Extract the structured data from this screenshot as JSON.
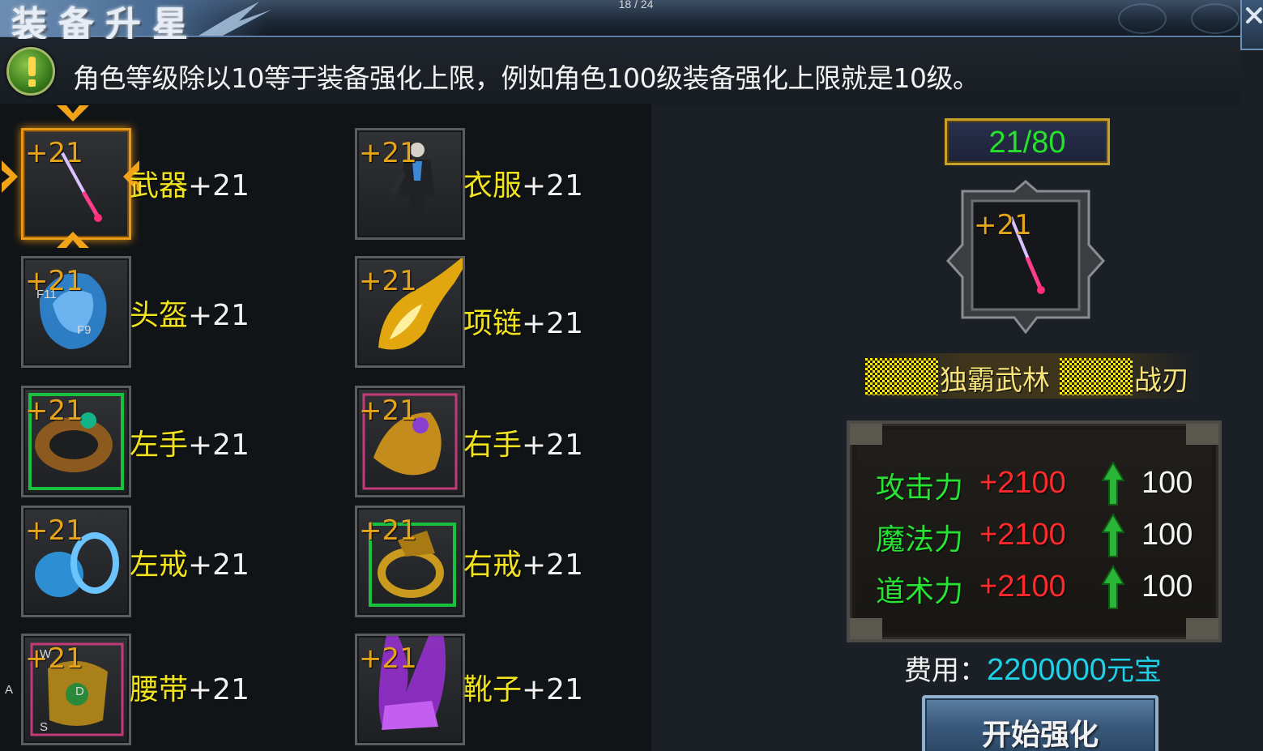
{
  "title": "装备升星",
  "page_counter": "18 / 24",
  "notice": "角色等级除以10等于装备强化上限，例如角色100级装备强化上限就是10级。",
  "slots": [
    {
      "label": "武器",
      "suffix": "+21",
      "level": "+21",
      "selected": true,
      "icon": "sword-icon"
    },
    {
      "label": "衣服",
      "suffix": "+21",
      "level": "+21",
      "icon": "armor-icon"
    },
    {
      "label": "头盔",
      "suffix": "+21",
      "level": "+21",
      "icon": "helmet-icon"
    },
    {
      "label": "项链",
      "suffix": "+21",
      "level": "+21",
      "icon": "necklace-icon"
    },
    {
      "label": "左手",
      "suffix": "+21",
      "level": "+21",
      "icon": "bracelet-left-icon"
    },
    {
      "label": "右手",
      "suffix": "+21",
      "level": "+21",
      "icon": "bracelet-right-icon"
    },
    {
      "label": "左戒",
      "suffix": "+21",
      "level": "+21",
      "icon": "ring-left-icon"
    },
    {
      "label": "右戒",
      "suffix": "+21",
      "level": "+21",
      "icon": "ring-right-icon"
    },
    {
      "label": "腰带",
      "suffix": "+21",
      "level": "+21",
      "icon": "belt-icon"
    },
    {
      "label": "靴子",
      "suffix": "+21",
      "level": "+21",
      "icon": "boots-icon"
    }
  ],
  "slot_hints": {
    "helmet_a": "F11",
    "helmet_b": "F9",
    "belt_w": "W",
    "belt_d": "D",
    "belt_s": "S",
    "side_a": "A"
  },
  "detail": {
    "progress": "21/80",
    "progress_value": 21,
    "progress_max": 80,
    "level": "+21",
    "name_part1": "独霸武林",
    "name_part2": "战刃",
    "stats": [
      {
        "name": "攻击力",
        "value": "+2100",
        "increase": "100"
      },
      {
        "name": "魔法力",
        "value": "+2100",
        "increase": "100"
      },
      {
        "name": "道术力",
        "value": "+2100",
        "increase": "100"
      }
    ],
    "cost_label": "费用：",
    "cost_value": "2200000",
    "cost_unit": "元宝",
    "start_button": "开始强化"
  },
  "colors": {
    "level_text": "#e6a41a",
    "slot_label": "#f1e21e",
    "stat_name": "#26e334",
    "stat_value": "#ff2a2a",
    "cost_value": "#1fd1e6",
    "progress_text": "#25e32a",
    "selected_border": "#e69a17"
  }
}
